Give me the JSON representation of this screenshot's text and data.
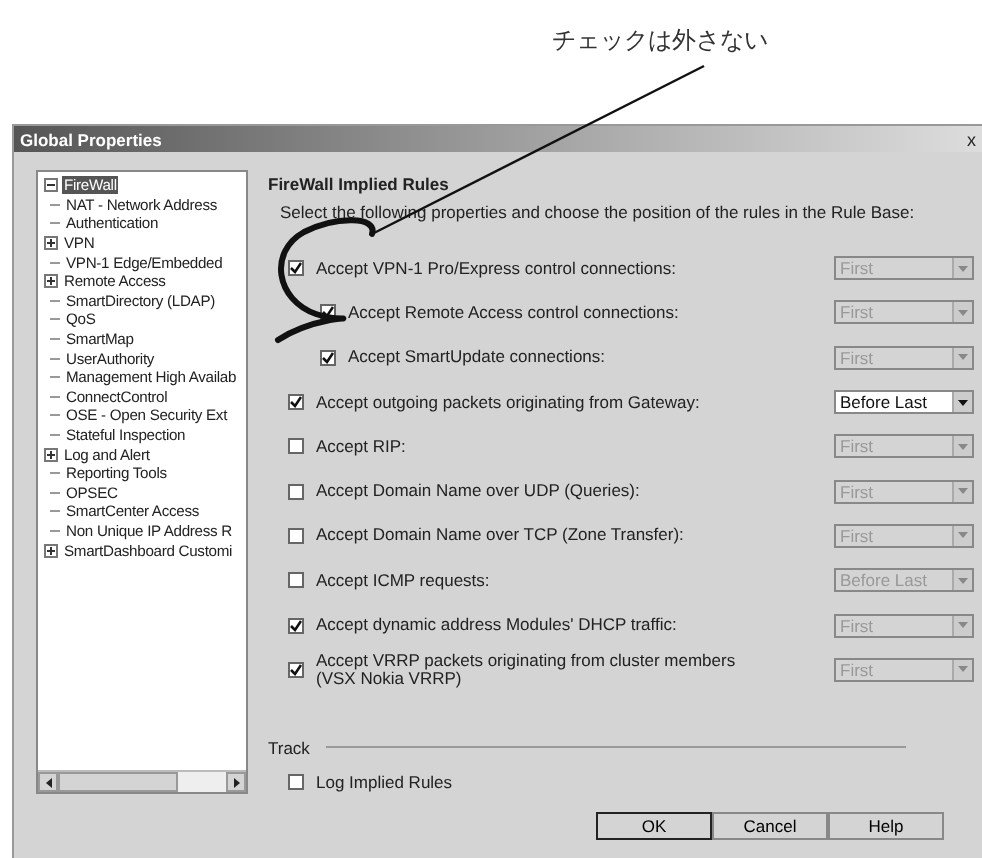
{
  "annotation": {
    "text": "チェックは外さない"
  },
  "window": {
    "title": "Global Properties",
    "close": "x"
  },
  "tree": {
    "items": [
      {
        "label": "FireWall",
        "kind": "branch",
        "expanded": true,
        "selected": true
      },
      {
        "label": "NAT - Network Address",
        "kind": "leaf",
        "selected": false
      },
      {
        "label": "Authentication",
        "kind": "leaf",
        "selected": false
      },
      {
        "label": "VPN",
        "kind": "branch",
        "expanded": false,
        "selected": false
      },
      {
        "label": "VPN-1 Edge/Embedded",
        "kind": "leaf",
        "selected": false
      },
      {
        "label": "Remote Access",
        "kind": "branch",
        "expanded": false,
        "selected": false
      },
      {
        "label": "SmartDirectory (LDAP)",
        "kind": "leaf",
        "selected": false
      },
      {
        "label": "QoS",
        "kind": "leaf",
        "selected": false
      },
      {
        "label": "SmartMap",
        "kind": "leaf",
        "selected": false
      },
      {
        "label": "UserAuthority",
        "kind": "leaf",
        "selected": false
      },
      {
        "label": "Management High Availab",
        "kind": "leaf",
        "selected": false
      },
      {
        "label": "ConnectControl",
        "kind": "leaf",
        "selected": false
      },
      {
        "label": "OSE - Open Security Ext",
        "kind": "leaf",
        "selected": false
      },
      {
        "label": "Stateful Inspection",
        "kind": "leaf",
        "selected": false
      },
      {
        "label": "Log and Alert",
        "kind": "branch",
        "expanded": false,
        "selected": false
      },
      {
        "label": "Reporting Tools",
        "kind": "leaf",
        "selected": false
      },
      {
        "label": "OPSEC",
        "kind": "leaf",
        "selected": false
      },
      {
        "label": "SmartCenter Access",
        "kind": "leaf",
        "selected": false
      },
      {
        "label": "Non Unique IP Address R",
        "kind": "leaf",
        "selected": false
      },
      {
        "label": "SmartDashboard Customi",
        "kind": "branch",
        "expanded": false,
        "selected": false
      }
    ]
  },
  "panel": {
    "title": "FireWall Implied Rules",
    "description": "Select the following properties and choose the position of the rules in the Rule Base:",
    "rules": [
      {
        "label": "Accept VPN-1 Pro/Express control connections:",
        "checked": true,
        "sub": false,
        "position": "First",
        "enabled": false
      },
      {
        "label": "Accept Remote Access control connections:",
        "checked": true,
        "sub": true,
        "position": "First",
        "enabled": false
      },
      {
        "label": "Accept SmartUpdate connections:",
        "checked": true,
        "sub": true,
        "position": "First",
        "enabled": false
      },
      {
        "label": "Accept outgoing packets originating from Gateway:",
        "checked": true,
        "sub": false,
        "position": "Before Last",
        "enabled": true
      },
      {
        "label": "Accept RIP:",
        "checked": false,
        "sub": false,
        "position": "First",
        "enabled": false
      },
      {
        "label": "Accept Domain Name over UDP (Queries):",
        "checked": false,
        "sub": false,
        "position": "First",
        "enabled": false
      },
      {
        "label": "Accept Domain Name over TCP (Zone Transfer):",
        "checked": false,
        "sub": false,
        "position": "First",
        "enabled": false
      },
      {
        "label": "Accept ICMP requests:",
        "checked": false,
        "sub": false,
        "position": "Before Last",
        "enabled": false
      },
      {
        "label": "Accept dynamic address Modules' DHCP traffic:",
        "checked": true,
        "sub": false,
        "position": "First",
        "enabled": false
      },
      {
        "label": "Accept VRRP packets originating from cluster members\n(VSX Nokia VRRP)",
        "checked": true,
        "sub": false,
        "position": "First",
        "enabled": false
      }
    ],
    "track": {
      "title": "Track",
      "options": [
        {
          "label": "Log Implied Rules",
          "checked": false
        }
      ]
    }
  },
  "buttons": [
    {
      "label": "OK",
      "default": true
    },
    {
      "label": "Cancel",
      "default": false
    },
    {
      "label": "Help",
      "default": false
    }
  ]
}
